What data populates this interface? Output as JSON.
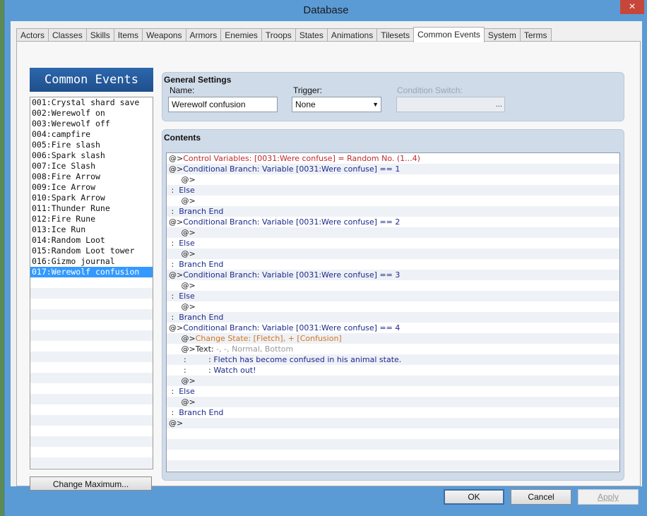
{
  "window": {
    "title": "Database",
    "close_label": "×"
  },
  "tabs": [
    "Actors",
    "Classes",
    "Skills",
    "Items",
    "Weapons",
    "Armors",
    "Enemies",
    "Troops",
    "States",
    "Animations",
    "Tilesets",
    "Common Events",
    "System",
    "Terms"
  ],
  "active_tab": "Common Events",
  "left_panel": {
    "title": "Common Events",
    "items": [
      "001:Crystal shard save",
      "002:Werewolf on",
      "003:Werewolf off",
      "004:campfire",
      "005:Fire slash",
      "006:Spark slash",
      "007:Ice Slash",
      "008:Fire Arrow",
      "009:Ice Arrow",
      "010:Spark Arrow",
      "011:Thunder Rune",
      "012:Fire Rune",
      "013:Ice Run",
      "014:Random Loot",
      "015:Random Loot tower",
      "016:Gizmo journal",
      "017:Werewolf confusion"
    ],
    "selected_index": 16,
    "change_max_label": "Change Maximum..."
  },
  "general": {
    "title": "General Settings",
    "name_label": "Name:",
    "name_value": "Werewolf confusion",
    "trigger_label": "Trigger:",
    "trigger_value": "None",
    "condition_label": "Condition Switch:",
    "condition_button": "..."
  },
  "contents": {
    "title": "Contents",
    "lines": [
      {
        "prefix": "@>",
        "text": "Control Variables: [0031:Were confuse] = Random No. (1...4)",
        "color": "red"
      },
      {
        "prefix": "@>",
        "text": "Conditional Branch: Variable [0031:Were confuse] == 1",
        "color": "blue"
      },
      {
        "prefix": "     @>",
        "text": "",
        "color": "blue"
      },
      {
        "prefix": " :  ",
        "text": "Else",
        "color": "blue"
      },
      {
        "prefix": "     @>",
        "text": "",
        "color": "blue"
      },
      {
        "prefix": " :  ",
        "text": "Branch End",
        "color": "blue"
      },
      {
        "prefix": "@>",
        "text": "Conditional Branch: Variable [0031:Were confuse] == 2",
        "color": "blue"
      },
      {
        "prefix": "     @>",
        "text": "",
        "color": "blue"
      },
      {
        "prefix": " :  ",
        "text": "Else",
        "color": "blue"
      },
      {
        "prefix": "     @>",
        "text": "",
        "color": "blue"
      },
      {
        "prefix": " :  ",
        "text": "Branch End",
        "color": "blue"
      },
      {
        "prefix": "@>",
        "text": "Conditional Branch: Variable [0031:Were confuse] == 3",
        "color": "blue"
      },
      {
        "prefix": "     @>",
        "text": "",
        "color": "blue"
      },
      {
        "prefix": " :  ",
        "text": "Else",
        "color": "blue"
      },
      {
        "prefix": "     @>",
        "text": "",
        "color": "blue"
      },
      {
        "prefix": " :  ",
        "text": "Branch End",
        "color": "blue"
      },
      {
        "prefix": "@>",
        "text": "Conditional Branch: Variable [0031:Were confuse] == 4",
        "color": "blue"
      },
      {
        "prefix": "     @>",
        "text": "Change State: [Fletch], + [Confusion]",
        "color": "orange"
      },
      {
        "prefix": "     @>Text: ",
        "text": "-, -, Normal, Bottom",
        "color": "gray"
      },
      {
        "prefix": "      :         : ",
        "text": "Fletch has become confused in his animal state.",
        "color": "blue"
      },
      {
        "prefix": "      :         : ",
        "text": "Watch out!",
        "color": "blue"
      },
      {
        "prefix": "     @>",
        "text": "",
        "color": "blue"
      },
      {
        "prefix": " :  ",
        "text": "Else",
        "color": "blue"
      },
      {
        "prefix": "     @>",
        "text": "",
        "color": "blue"
      },
      {
        "prefix": " :  ",
        "text": "Branch End",
        "color": "blue"
      },
      {
        "prefix": "@>",
        "text": "",
        "color": "blue"
      }
    ]
  },
  "buttons": {
    "ok": "OK",
    "cancel": "Cancel",
    "apply": "Apply"
  }
}
